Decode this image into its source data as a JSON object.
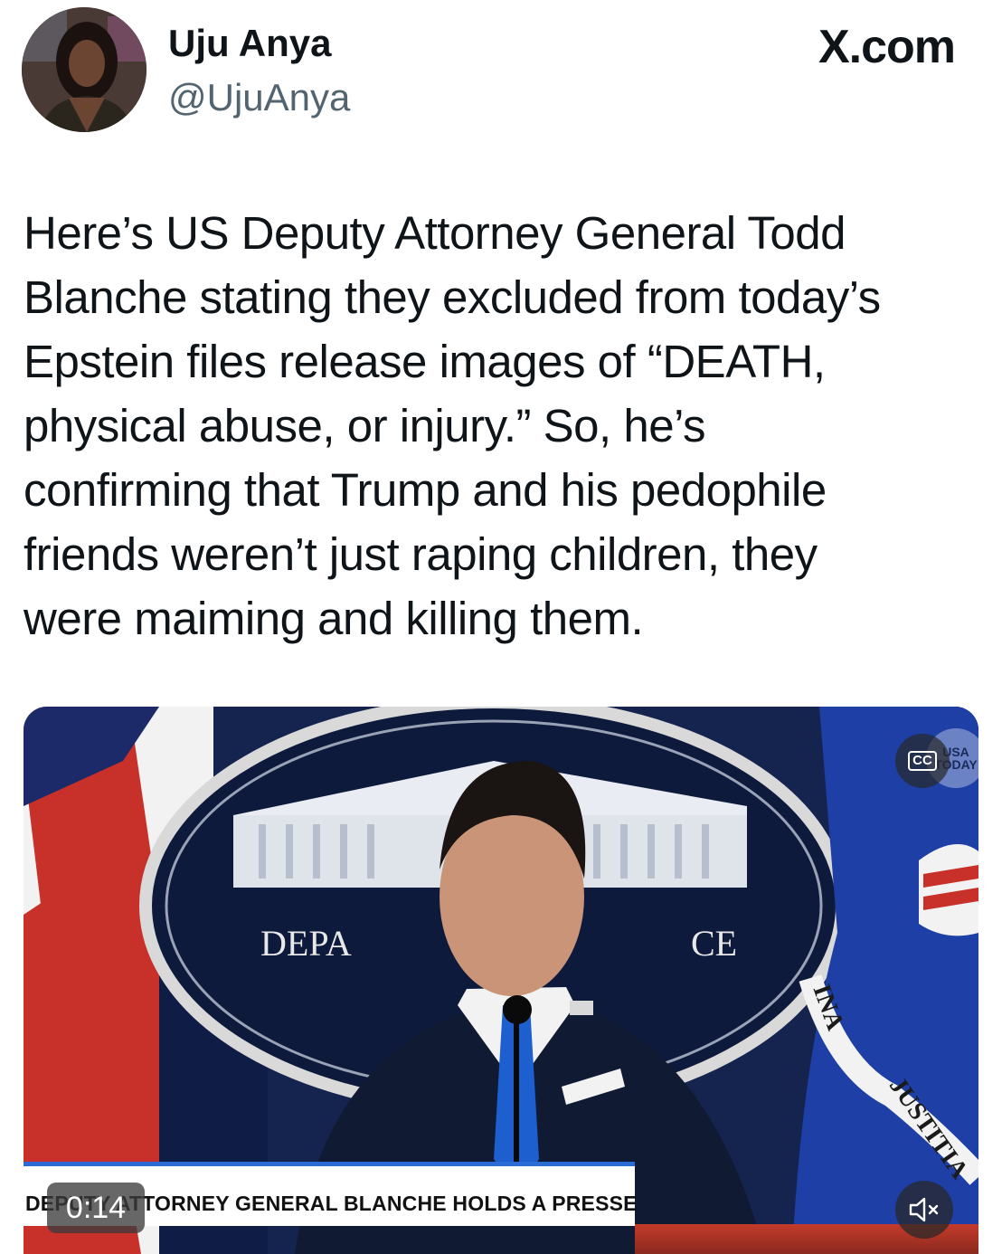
{
  "header": {
    "display_name": "Uju Anya",
    "handle": "@UjuAnya",
    "site": "X.com",
    "avatar_icon": "profile-photo"
  },
  "tweet": {
    "text": "Here’s US Deputy Attorney General Todd\nBlanche stating they excluded from today’s\nEpstein files release images of “DEATH,\nphysical abuse, or injury.” So, he’s\nconfirming that Trump and his pedophile\nfriends weren’t just raping children, they\nwere maiming and killing them."
  },
  "video": {
    "lower_third": "DEPUTY ATTORNEY GENERAL BLANCHE HOLDS A PRESSER",
    "timestamp": "0:14",
    "cc_label": "CC",
    "channel_logo": "USA TODAY",
    "seal_text_left": "DEPA",
    "seal_text_right": "CE",
    "flag_text_1": "INA",
    "flag_text_2": "JUSTITIA",
    "mute_icon": "speaker-muted-icon",
    "colors": {
      "backdrop": "#14224a",
      "flag_blue": "#1d3fa6",
      "lower_third_accent": "#2b6bd6"
    }
  }
}
